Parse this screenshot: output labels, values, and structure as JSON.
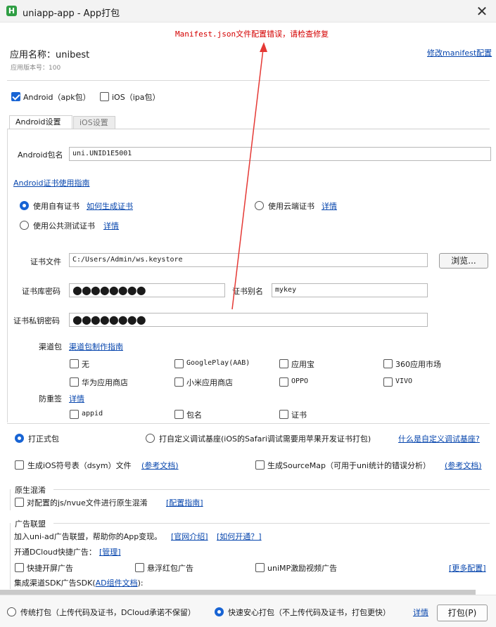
{
  "window": {
    "title": "uniapp-app - App打包",
    "logo": "H"
  },
  "error_banner": "Manifest.json文件配置错误，请检查修复",
  "app": {
    "name_label": "应用名称：unibest",
    "version_label": "应用版本号：100",
    "modify_link": "修改manifest配置"
  },
  "platforms": {
    "android": {
      "label": "Android（apk包）",
      "checked": true
    },
    "ios": {
      "label": "iOS（ipa包）",
      "checked": false
    }
  },
  "tabs": [
    {
      "label": "Android设置",
      "active": true
    },
    {
      "label": "iOS设置",
      "active": false
    }
  ],
  "android": {
    "package_label": "Android包名",
    "package_value": "uni.UNID1E5001",
    "cert_guide_link": "Android证书使用指南",
    "cert_options": {
      "own": {
        "label": "使用自有证书",
        "link": "如何生成证书",
        "checked": true
      },
      "cloud": {
        "label": "使用云端证书",
        "link": "详情",
        "checked": false
      },
      "public": {
        "label": "使用公共测试证书",
        "link": "详情",
        "checked": false
      }
    },
    "cert_file_label": "证书文件",
    "cert_file_value": "C:/Users/Admin/ws.keystore",
    "browse_button": "浏览...",
    "store_pwd_label": "证书库密码",
    "store_pwd_value": "●●●●●●●●",
    "alias_label": "证书别名",
    "alias_value": "mykey",
    "key_pwd_label": "证书私钥密码",
    "key_pwd_value": "●●●●●●●●",
    "channel_label": "渠道包",
    "channel_link": "渠道包制作指南",
    "channels": [
      {
        "label": "无",
        "checked": false
      },
      {
        "label": "GooglePlay(AAB)",
        "checked": false
      },
      {
        "label": "应用宝",
        "checked": false
      },
      {
        "label": "360应用市场",
        "checked": false
      },
      {
        "label": "华为应用商店",
        "checked": false
      },
      {
        "label": "小米应用商店",
        "checked": false
      },
      {
        "label": "OPPO",
        "checked": false
      },
      {
        "label": "VIVO",
        "checked": false
      }
    ],
    "anti_label": "防重签",
    "anti_link": "详情",
    "anti_options": [
      {
        "label": "appid",
        "checked": false
      },
      {
        "label": "包名",
        "checked": false
      },
      {
        "label": "证书",
        "checked": false
      }
    ]
  },
  "build_type": {
    "formal": {
      "label": "打正式包",
      "checked": true
    },
    "custom": {
      "label": "打自定义调试基座(iOS的Safari调试需要用苹果开发证书打包)",
      "checked": false
    },
    "custom_link": "什么是自定义调试基座?"
  },
  "symbols": {
    "dsym_label": "生成iOS符号表（dsym）文件",
    "dsym_link": "(参考文档)",
    "sourcemap_label": "生成SourceMap（可用于uni统计的错误分析）",
    "sourcemap_link": "(参考文档)"
  },
  "obfuscation": {
    "section_title": "原生混淆",
    "option_label": "对配置的js/nvue文件进行原生混淆",
    "link": "[配置指南]"
  },
  "ads": {
    "section_title": "广告联盟",
    "join_text": "加入uni-ad广告联盟，帮助你的App变现。",
    "join_link1": "[官网介绍]",
    "join_link2": "[如何开通？]",
    "dcloud_text": "开通DCloud快捷广告：",
    "dcloud_link": "[管理]",
    "options": [
      {
        "label": "快捷开屏广告",
        "checked": false
      },
      {
        "label": "悬浮红包广告",
        "checked": false
      },
      {
        "label": "uniMP激励视频广告",
        "checked": false
      }
    ],
    "more_link": "[更多配置]",
    "sdk_text_prefix": "集成渠道SDK广告SDK(",
    "sdk_link": "AD组件文档",
    "sdk_text_suffix": "):"
  },
  "bottom": {
    "traditional": {
      "label": "传统打包（上传代码及证书，DCloud承诺不保留）",
      "checked": false
    },
    "fast": {
      "label": "快速安心打包（不上传代码及证书，打包更快）",
      "checked": true
    },
    "detail_link": "详情",
    "pack_button": "打包(P)"
  },
  "colors": {
    "error_text": "#d40000",
    "accent": "#1864d4",
    "link": "#0645ad",
    "arrow": "#e53935"
  }
}
